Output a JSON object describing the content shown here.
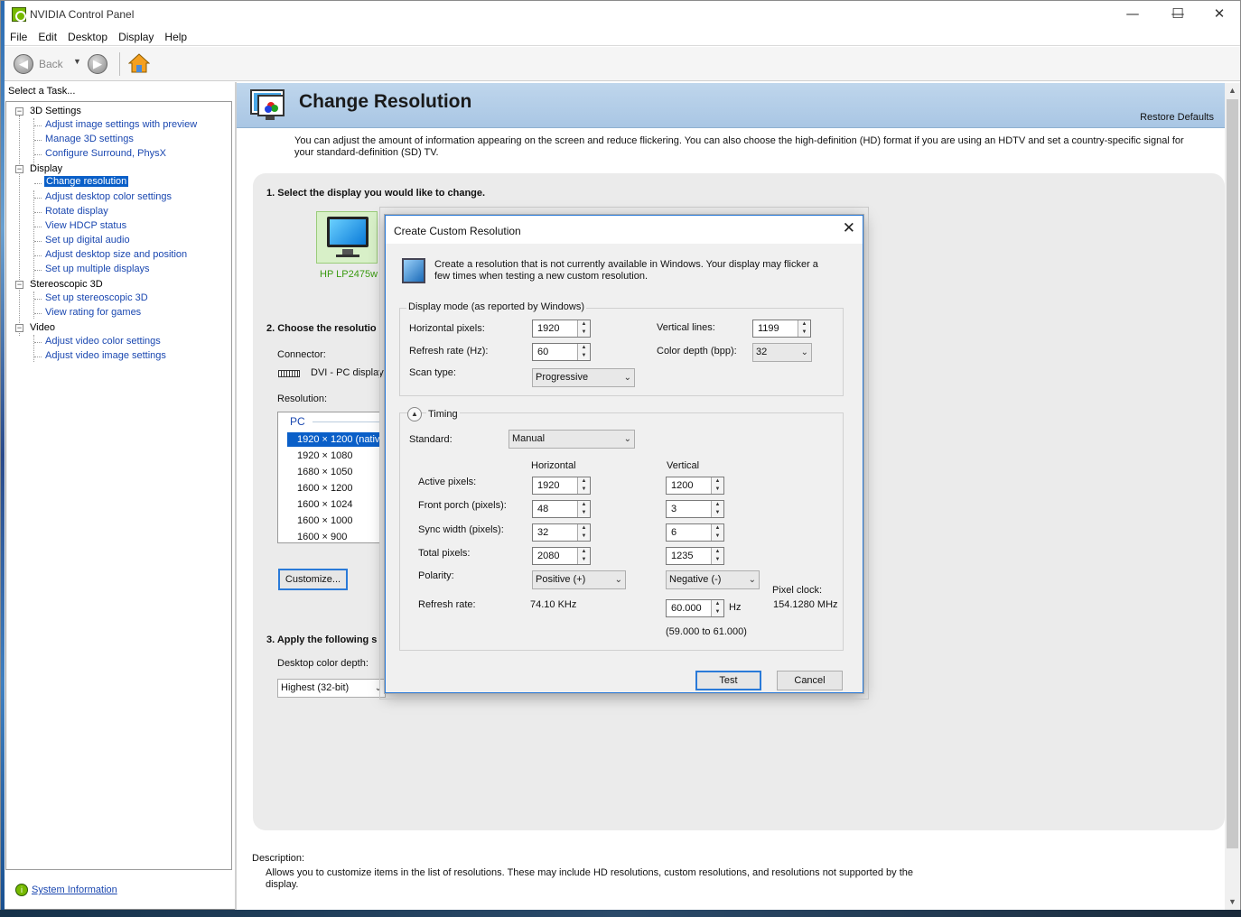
{
  "app": {
    "title": "NVIDIA Control Panel"
  },
  "window_controls": {
    "minimize": "—",
    "maximize": "☐",
    "close": "✕"
  },
  "menu": [
    "File",
    "Edit",
    "Desktop",
    "Display",
    "Help"
  ],
  "toolbar": {
    "back_label": "Back"
  },
  "left": {
    "task_label": "Select a Task...",
    "tree": [
      {
        "label": "3D Settings",
        "type": "category"
      },
      {
        "label": "Adjust image settings with preview",
        "type": "link"
      },
      {
        "label": "Manage 3D settings",
        "type": "link"
      },
      {
        "label": "Configure Surround, PhysX",
        "type": "link"
      },
      {
        "label": "Display",
        "type": "category"
      },
      {
        "label": "Change resolution",
        "type": "link",
        "selected": true
      },
      {
        "label": "Adjust desktop color settings",
        "type": "link"
      },
      {
        "label": "Rotate display",
        "type": "link"
      },
      {
        "label": "View HDCP status",
        "type": "link"
      },
      {
        "label": "Set up digital audio",
        "type": "link"
      },
      {
        "label": "Adjust desktop size and position",
        "type": "link"
      },
      {
        "label": "Set up multiple displays",
        "type": "link"
      },
      {
        "label": "Stereoscopic 3D",
        "type": "category"
      },
      {
        "label": "Set up stereoscopic 3D",
        "type": "link"
      },
      {
        "label": "View rating for games",
        "type": "link"
      },
      {
        "label": "Video",
        "type": "category"
      },
      {
        "label": "Adjust video color settings",
        "type": "link"
      },
      {
        "label": "Adjust video image settings",
        "type": "link"
      }
    ],
    "system_info": "System Information"
  },
  "page": {
    "title": "Change Resolution",
    "restore_defaults": "Restore Defaults",
    "intro": "You can adjust the amount of information appearing on the screen and reduce flickering. You can also choose the high-definition (HD) format if you are using an HDTV and set a country-specific signal for your standard-definition (SD) TV.",
    "step1": "1. Select the display you would like to change.",
    "display_name": "HP LP2475w",
    "step2": "2. Choose the resolutio",
    "connector_label": "Connector:",
    "connector_value": "DVI - PC display",
    "resolution_label": "Resolution:",
    "res_group": "PC",
    "resolutions": [
      "1920 × 1200 (nativ",
      "1920 × 1080",
      "1680 × 1050",
      "1600 × 1200",
      "1600 × 1024",
      "1600 × 1000",
      "1600 × 900"
    ],
    "customize": "Customize...",
    "step3": "3. Apply the following s",
    "color_depth_label": "Desktop color depth:",
    "color_depth_value": "Highest (32-bit)",
    "description_label": "Description:",
    "description_text": "Allows you to customize items in the list of resolutions. These may include HD resolutions, custom resolutions, and resolutions not supported by the display."
  },
  "dialog": {
    "title": "Create Custom Resolution",
    "close": "✕",
    "intro": "Create a resolution that is not currently available in Windows. Your display may flicker a few times when testing a new custom resolution.",
    "display_mode_label": "Display mode (as reported by Windows)",
    "horizontal_pixels_label": "Horizontal pixels:",
    "horizontal_pixels": "1920",
    "vertical_lines_label": "Vertical lines:",
    "vertical_lines": "1199",
    "refresh_rate_label": "Refresh rate (Hz):",
    "refresh_rate": "60",
    "color_depth_label": "Color depth (bpp):",
    "color_depth": "32",
    "scan_type_label": "Scan type:",
    "scan_type": "Progressive",
    "timing_label": "Timing",
    "standard_label": "Standard:",
    "standard": "Manual",
    "col_horizontal": "Horizontal",
    "col_vertical": "Vertical",
    "active_pixels_label": "Active pixels:",
    "active_h": "1920",
    "active_v": "1200",
    "front_porch_label": "Front porch (pixels):",
    "front_h": "48",
    "front_v": "3",
    "sync_width_label": "Sync width (pixels):",
    "sync_h": "32",
    "sync_v": "6",
    "total_pixels_label": "Total pixels:",
    "total_h": "2080",
    "total_v": "1235",
    "polarity_label": "Polarity:",
    "polarity_h": "Positive (+)",
    "polarity_v": "Negative (-)",
    "refresh_label": "Refresh rate:",
    "refresh_h": "74.10 KHz",
    "refresh_v": "60.000",
    "refresh_unit": "Hz",
    "refresh_range": "(59.000 to 61.000)",
    "pixel_clock_label": "Pixel clock:",
    "pixel_clock": "154.1280 MHz",
    "test": "Test",
    "cancel": "Cancel"
  }
}
